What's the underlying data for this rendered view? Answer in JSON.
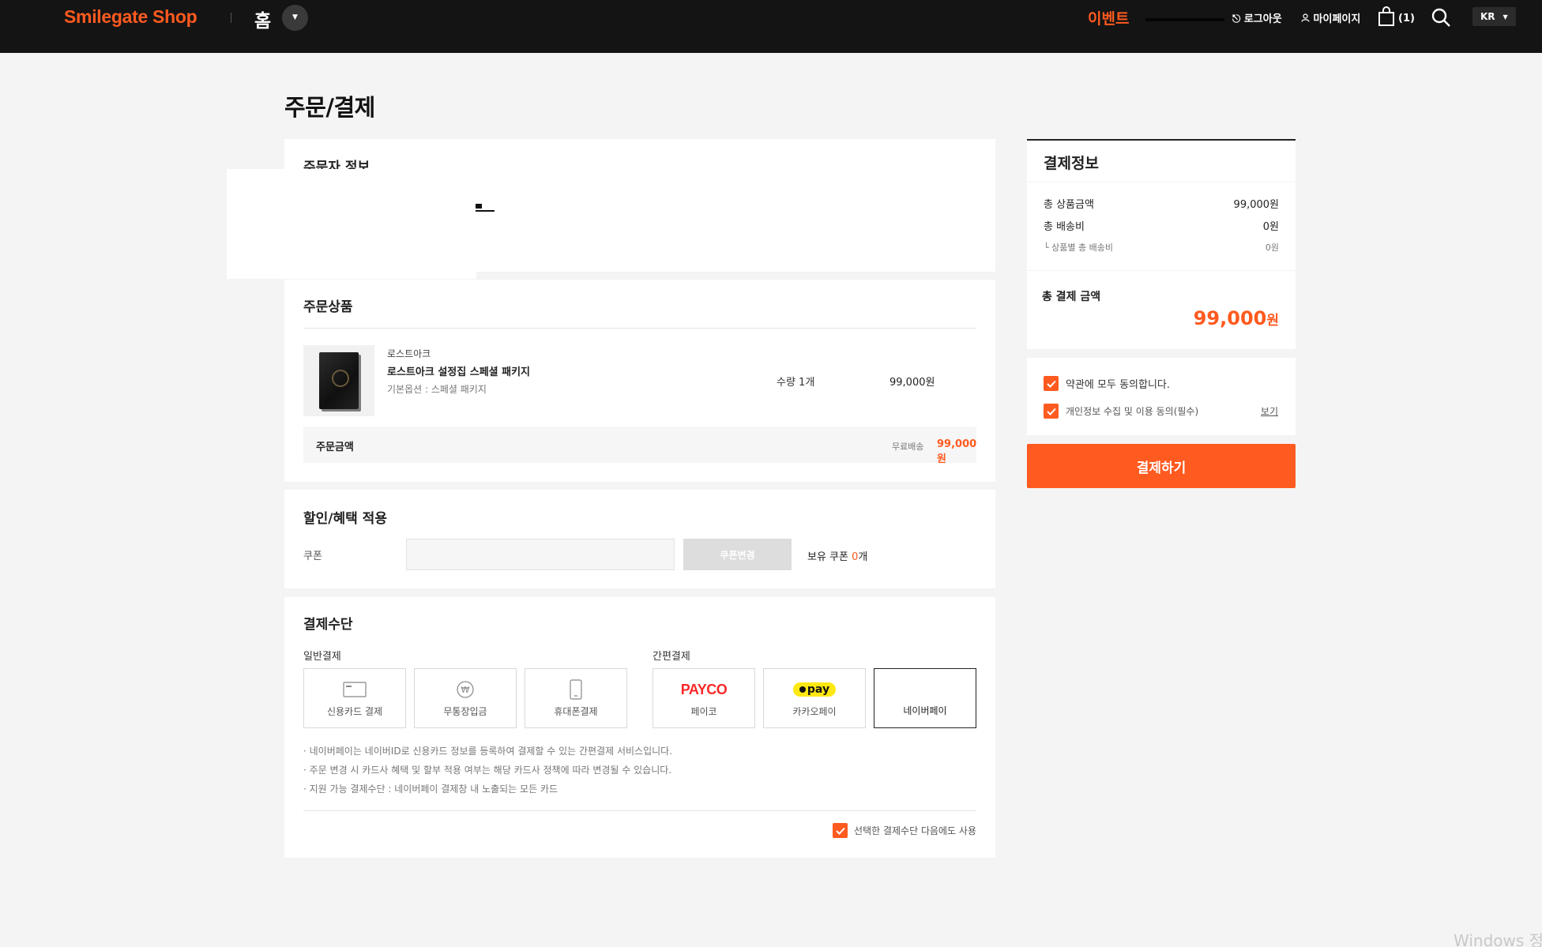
{
  "header": {
    "logo": "Smilegate Shop",
    "home_label": "홈",
    "event_label": "이벤트",
    "logout_label": "로그아웃",
    "mypage_label": "마이페이지",
    "cart_count": "(1)",
    "lang": "KR"
  },
  "page": {
    "title": "주문/결제"
  },
  "orderer": {
    "title": "주문자 정보"
  },
  "products": {
    "title": "주문상품",
    "items": [
      {
        "brand": "로스트아크",
        "name": "로스트아크 설정집 스페셜 패키지",
        "option": "기본옵션 : 스페셜 패키지",
        "qty": "수량 1개",
        "price": "99,000원"
      }
    ],
    "summary": {
      "label": "주문금액",
      "shipping": "무료배송",
      "amount": "99,000원"
    }
  },
  "discount": {
    "title": "할인/혜택 적용",
    "coupon_label": "쿠폰",
    "coupon_value": "",
    "coupon_button": "쿠폰변경",
    "owned_prefix": "보유 쿠폰 ",
    "owned_count": "0",
    "owned_suffix": "개"
  },
  "payment": {
    "title": "결제수단",
    "general_label": "일반결제",
    "easy_label": "간편결제",
    "general_options": [
      {
        "label": "신용카드 결제",
        "icon": "credit-card-icon"
      },
      {
        "label": "무통장입금",
        "icon": "won-coin-icon"
      },
      {
        "label": "휴대폰결제",
        "icon": "mobile-phone-icon"
      }
    ],
    "easy_options": [
      {
        "label": "페이코",
        "logo": "PAYCO"
      },
      {
        "label": "카카오페이",
        "logo": "pay"
      },
      {
        "label": "네이버페이",
        "selected": true
      }
    ],
    "notes": [
      "· 네이버페이는 네이버ID로 신용카드 정보를 등록하여 결제할 수 있는 간편결제 서비스입니다.",
      "· 주문 변경 시 카드사 혜택 및 할부 적용 여부는 해당 카드사 정책에 따라 변경될 수 있습니다.",
      "· 지원 가능 결제수단 : 네이버페이 결제창 내 노출되는 모든 카드"
    ],
    "remember_label": "선택한 결제수단 다음에도 사용",
    "remember_checked": true
  },
  "summary": {
    "title": "결제정보",
    "rows": [
      {
        "label": "총 상품금액",
        "value": "99,000원"
      },
      {
        "label": "총 배송비",
        "value": "0원"
      },
      {
        "label": "└ 상품별 총 배송비",
        "value": "0원"
      }
    ],
    "total_label": "총 결제 금액",
    "total_amount": "99,000",
    "total_unit": "원",
    "agree_all": "약관에 모두 동의합니다.",
    "agree_privacy": "개인정보 수집 및 이용 동의(필수)",
    "view_link": "보기",
    "pay_button": "결제하기"
  },
  "os": {
    "watermark": "Windows 정"
  },
  "colors": {
    "accent": "#ff5a1f",
    "header_bg": "#141414",
    "page_bg": "#f4f4f4"
  }
}
